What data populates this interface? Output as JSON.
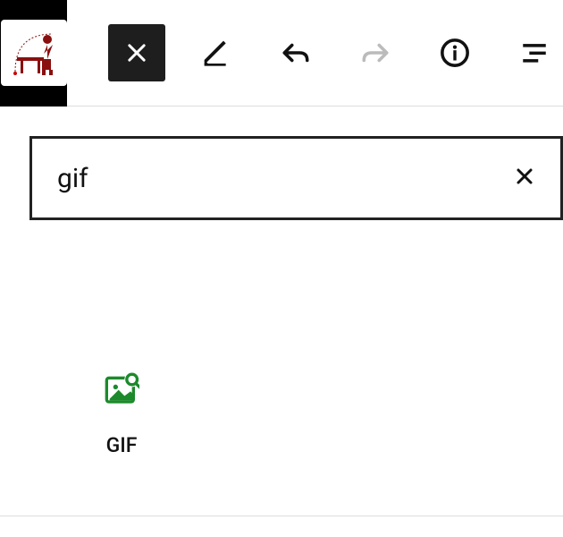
{
  "search": {
    "value": "gif"
  },
  "results": [
    {
      "label": "GIF",
      "icon": "gif-image-search-icon"
    }
  ]
}
